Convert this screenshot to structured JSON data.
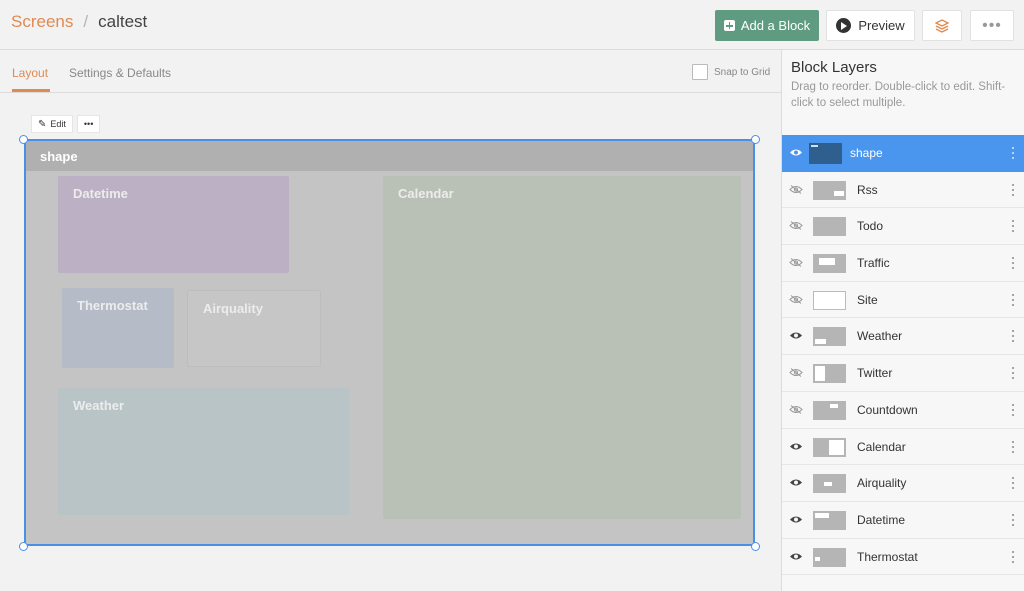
{
  "breadcrumb": {
    "root": "Screens",
    "separator": "/",
    "current": "caltest"
  },
  "header": {
    "add_block_label": "Add a Block",
    "preview_label": "Preview",
    "more_label": "•••"
  },
  "tabs": [
    {
      "label": "Layout",
      "active": true
    },
    {
      "label": "Settings & Defaults",
      "active": false
    }
  ],
  "snap_to_grid": {
    "label": "Snap to Grid",
    "checked": false
  },
  "canvas": {
    "edit_label": "Edit",
    "more_label": "•••",
    "shape_title": "shape",
    "blocks": {
      "datetime": "Datetime",
      "calendar": "Calendar",
      "thermostat": "Thermostat",
      "airquality": "Airquality",
      "weather": "Weather"
    }
  },
  "panel": {
    "title": "Block Layers",
    "help": "Drag to reorder. Double-click to edit. Shift-click to select multiple.",
    "layers": [
      {
        "name": "shape",
        "visible": true,
        "selected": true
      },
      {
        "name": "Rss",
        "visible": false
      },
      {
        "name": "Todo",
        "visible": false
      },
      {
        "name": "Traffic",
        "visible": false
      },
      {
        "name": "Site",
        "visible": false
      },
      {
        "name": "Weather",
        "visible": true
      },
      {
        "name": "Twitter",
        "visible": false
      },
      {
        "name": "Countdown",
        "visible": false
      },
      {
        "name": "Calendar",
        "visible": true
      },
      {
        "name": "Airquality",
        "visible": true
      },
      {
        "name": "Datetime",
        "visible": true
      },
      {
        "name": "Thermostat",
        "visible": true
      }
    ]
  },
  "colors": {
    "accent": "#e08a52",
    "primary_button": "#5f9b80",
    "selection": "#4a8fe7"
  }
}
